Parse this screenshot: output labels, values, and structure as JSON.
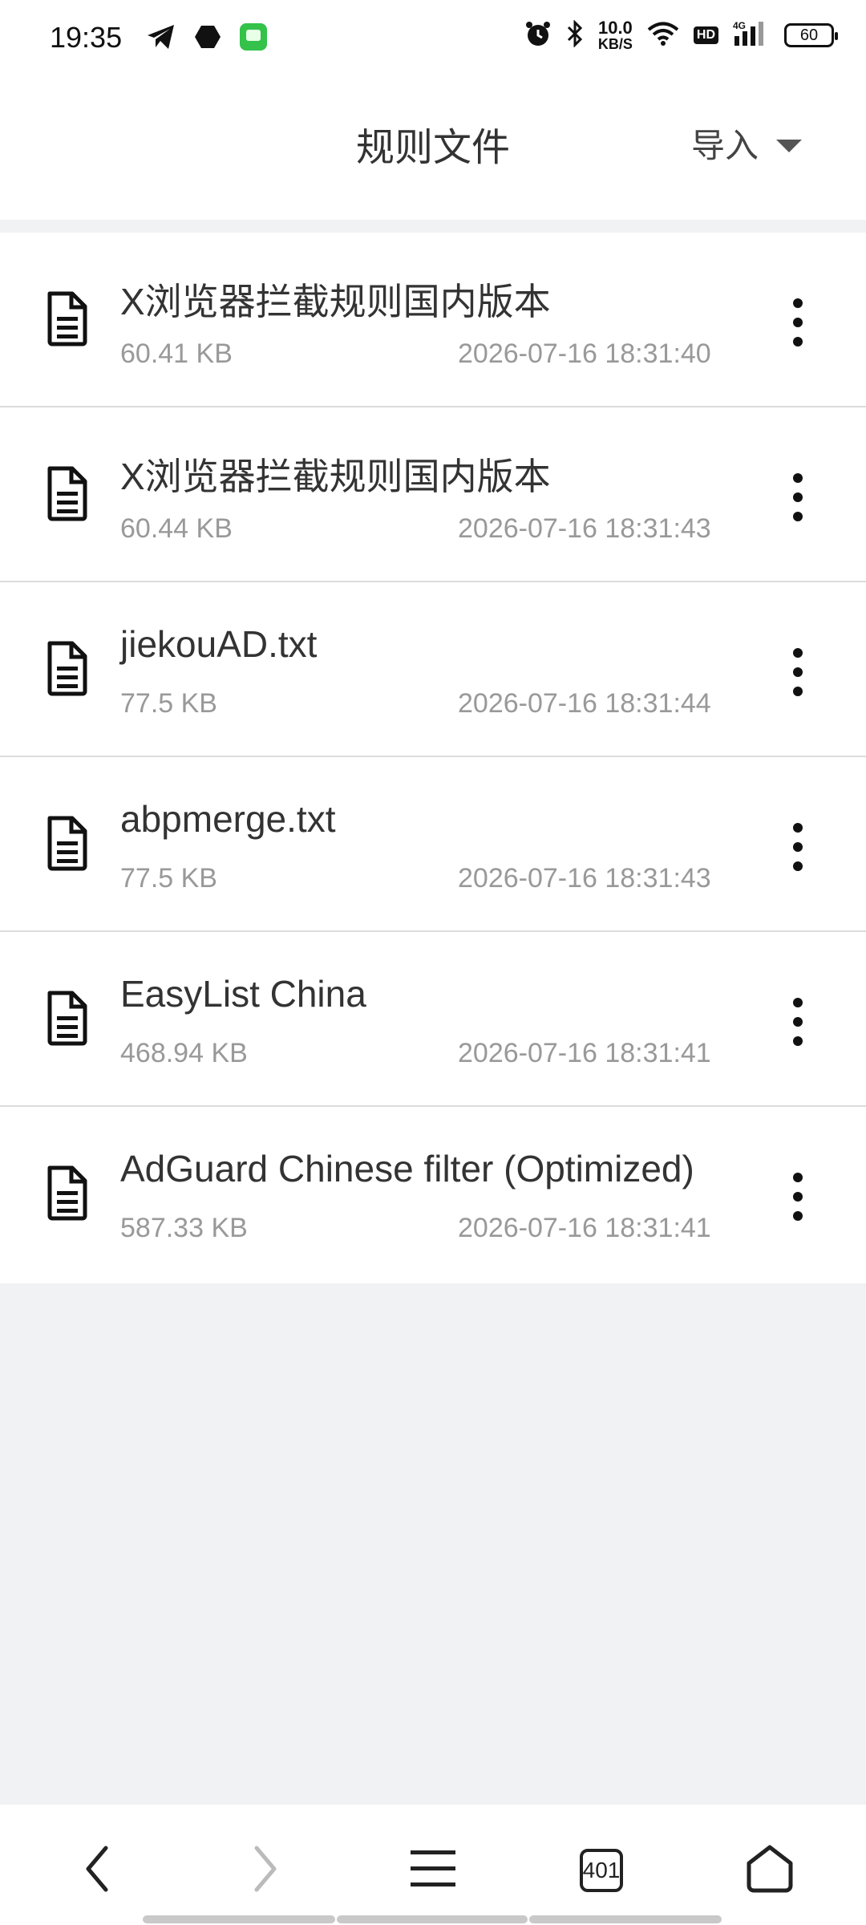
{
  "status": {
    "time": "19:35",
    "speed_value": "10.0",
    "speed_unit": "KB/S",
    "hd": "HD",
    "network": "4G",
    "battery": "60"
  },
  "header": {
    "title": "规则文件",
    "import_label": "导入"
  },
  "files": [
    {
      "name": "X浏览器拦截规则国内版本",
      "size": "60.41 KB",
      "date": "2026-07-16 18:31:40"
    },
    {
      "name": "X浏览器拦截规则国内版本",
      "size": "60.44 KB",
      "date": "2026-07-16 18:31:43"
    },
    {
      "name": "jiekouAD.txt",
      "size": "77.5 KB",
      "date": "2026-07-16 18:31:44"
    },
    {
      "name": "abpmerge.txt",
      "size": "77.5 KB",
      "date": "2026-07-16 18:31:43"
    },
    {
      "name": "EasyList China",
      "size": "468.94 KB",
      "date": "2026-07-16 18:31:41"
    },
    {
      "name": "AdGuard Chinese filter (Optimized)",
      "size": "587.33 KB",
      "date": "2026-07-16 18:31:41"
    }
  ],
  "bottom": {
    "tab_count": "401"
  },
  "icons": {
    "file": "file-text-icon",
    "more": "more-vertical-icon",
    "back": "chevron-left-icon",
    "forward": "chevron-right-icon",
    "menu": "menu-icon",
    "tabs": "tabs-icon",
    "home": "home-icon"
  }
}
